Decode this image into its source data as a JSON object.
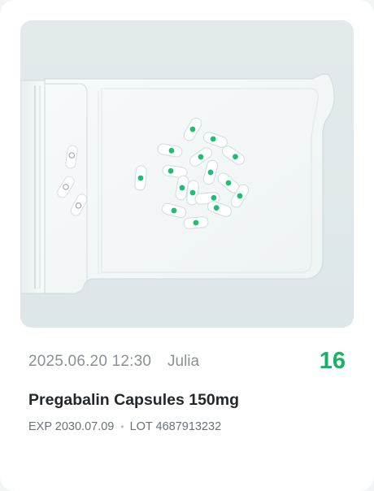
{
  "record": {
    "datetime": "2025.06.20 12:30",
    "user": "Julia",
    "count": "16",
    "drug_name": "Pregabalin Capsules 150mg",
    "exp": "EXP 2030.07.09",
    "separator": "•",
    "lot": "LOT 4687913232"
  },
  "colors": {
    "count": "#16b364",
    "capsule_dot": "#1dbf73",
    "tray": "#f4f7f7"
  }
}
